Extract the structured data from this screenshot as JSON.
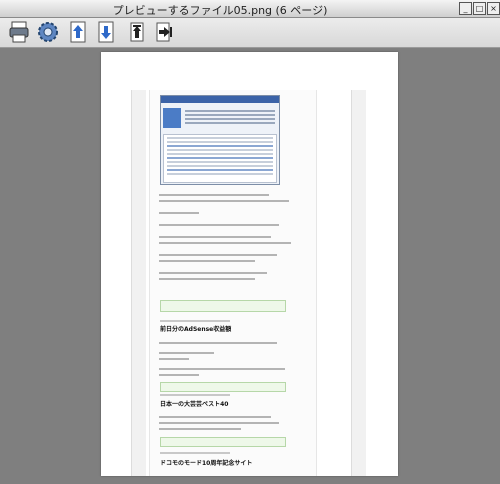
{
  "window": {
    "title": "プレビューするファイル05.png (6 ページ)",
    "buttons": [
      "minimize",
      "maximize",
      "close"
    ]
  },
  "toolbar": {
    "tools": [
      {
        "name": "print-button",
        "icon": "printer-icon"
      },
      {
        "name": "settings-button",
        "icon": "gear-icon"
      },
      {
        "name": "previous-page-button",
        "icon": "arrow-up-icon"
      },
      {
        "name": "next-page-button",
        "icon": "arrow-down-icon"
      },
      {
        "name": "first-page-button",
        "icon": "first-page-icon"
      },
      {
        "name": "last-page-button",
        "icon": "last-page-icon"
      }
    ]
  },
  "document": {
    "headings": [
      "前日分のAdSense収益額",
      "日本一の大芸芸ベスト40",
      "ドコモのモード10周年記念サイト"
    ]
  },
  "colors": {
    "viewer_background": "#7f7f7f",
    "page": "#ffffff",
    "accent_blue": "#3b63a8",
    "quote_green": "#eef8e9"
  }
}
